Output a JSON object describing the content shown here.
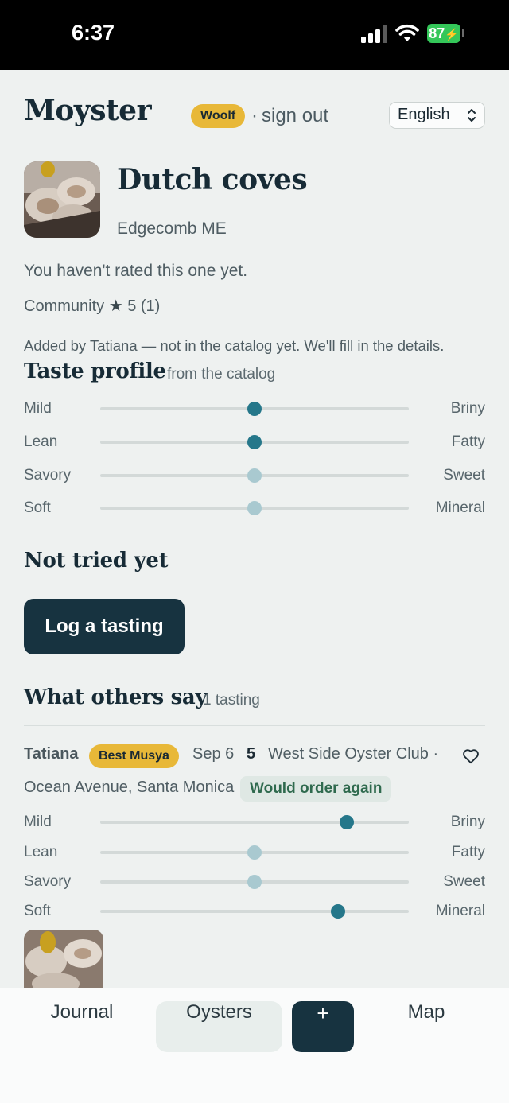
{
  "status_bar": {
    "time": "6:37",
    "battery": "87"
  },
  "header": {
    "logo": "Moyster",
    "user_badge": "Woolf",
    "signout_sep": "·",
    "signout": "sign out",
    "language": "English"
  },
  "oyster": {
    "name": "Dutch coves",
    "location": "Edgecomb ME",
    "rating_status": "You haven't rated this one yet.",
    "community_label": "Community",
    "community_star": "★",
    "community_score": "5 (1)",
    "added_note": "Added by Tatiana — not in the catalog yet. We'll fill in the details."
  },
  "taste_profile": {
    "title": "Taste profile",
    "source": "from the catalog",
    "rows": [
      {
        "left": "Mild",
        "right": "Briny",
        "value": 0.5,
        "emphasis": "strong"
      },
      {
        "left": "Lean",
        "right": "Fatty",
        "value": 0.5,
        "emphasis": "strong"
      },
      {
        "left": "Savory",
        "right": "Sweet",
        "value": 0.5,
        "emphasis": "faint"
      },
      {
        "left": "Soft",
        "right": "Mineral",
        "value": 0.5,
        "emphasis": "faint"
      }
    ]
  },
  "tried": {
    "title": "Not tried yet",
    "button": "Log a tasting"
  },
  "others": {
    "title": "What others say",
    "count": "1 tasting",
    "reviews": [
      {
        "author": "Tatiana",
        "badge": "Best Musya",
        "date": "Sep 6",
        "score": "5",
        "venue": "West Side Oyster Club ·",
        "address": "Ocean Avenue, Santa Monica",
        "tag": "Would order again",
        "taste": [
          {
            "left": "Mild",
            "right": "Briny",
            "value": 0.8,
            "emphasis": "strong"
          },
          {
            "left": "Lean",
            "right": "Fatty",
            "value": 0.5,
            "emphasis": "faint"
          },
          {
            "left": "Savory",
            "right": "Sweet",
            "value": 0.5,
            "emphasis": "faint"
          },
          {
            "left": "Soft",
            "right": "Mineral",
            "value": 0.77,
            "emphasis": "strong"
          }
        ]
      }
    ]
  },
  "tabbar": {
    "journal": "Journal",
    "oysters": "Oysters",
    "add": "+",
    "map": "Map"
  },
  "colors": {
    "accent_dark": "#173340",
    "slider_strong": "#25778a",
    "slider_faint": "#a9c9d0",
    "badge_yellow": "#e8b838",
    "battery_green": "#34c759"
  }
}
